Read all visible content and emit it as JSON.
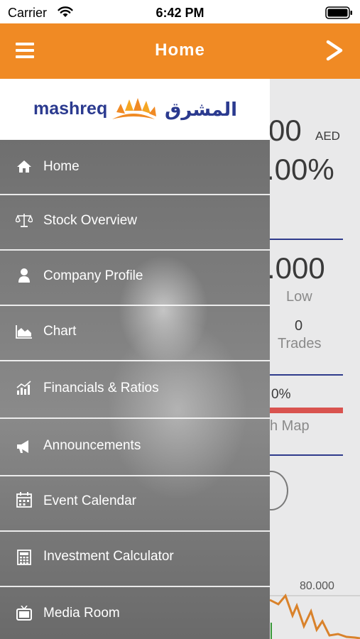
{
  "status_bar": {
    "carrier": "Carrier",
    "time": "6:42 PM"
  },
  "nav": {
    "title": "Home",
    "menu_icon": "hamburger-icon",
    "next_icon": "chevron-right-icon"
  },
  "brand": {
    "name_en": "mashreq",
    "name_ar": "المشرق",
    "brand_color": "#2b3a8f",
    "accent": "#f08a24"
  },
  "background_content": {
    "price": "00",
    "currency": "AED",
    "change": ".00%",
    "low_value": ".000",
    "low_label": "Low",
    "trades_value": "0",
    "trades_label": "Trades",
    "percent": "0%",
    "heat_map_label": "h Map",
    "chart_tick": "80.000"
  },
  "drawer": {
    "items": [
      {
        "label": "Home",
        "icon": "home-icon"
      },
      {
        "label": "Stock Overview",
        "icon": "scale-icon"
      },
      {
        "label": "Company Profile",
        "icon": "person-icon"
      },
      {
        "label": "Chart",
        "icon": "area-chart-icon"
      },
      {
        "label": "Financials & Ratios",
        "icon": "bar-chart-icon"
      },
      {
        "label": "Announcements",
        "icon": "megaphone-icon"
      },
      {
        "label": "Event Calendar",
        "icon": "calendar-icon"
      },
      {
        "label": "Investment Calculator",
        "icon": "calculator-icon"
      },
      {
        "label": "Media Room",
        "icon": "tv-icon"
      }
    ]
  }
}
